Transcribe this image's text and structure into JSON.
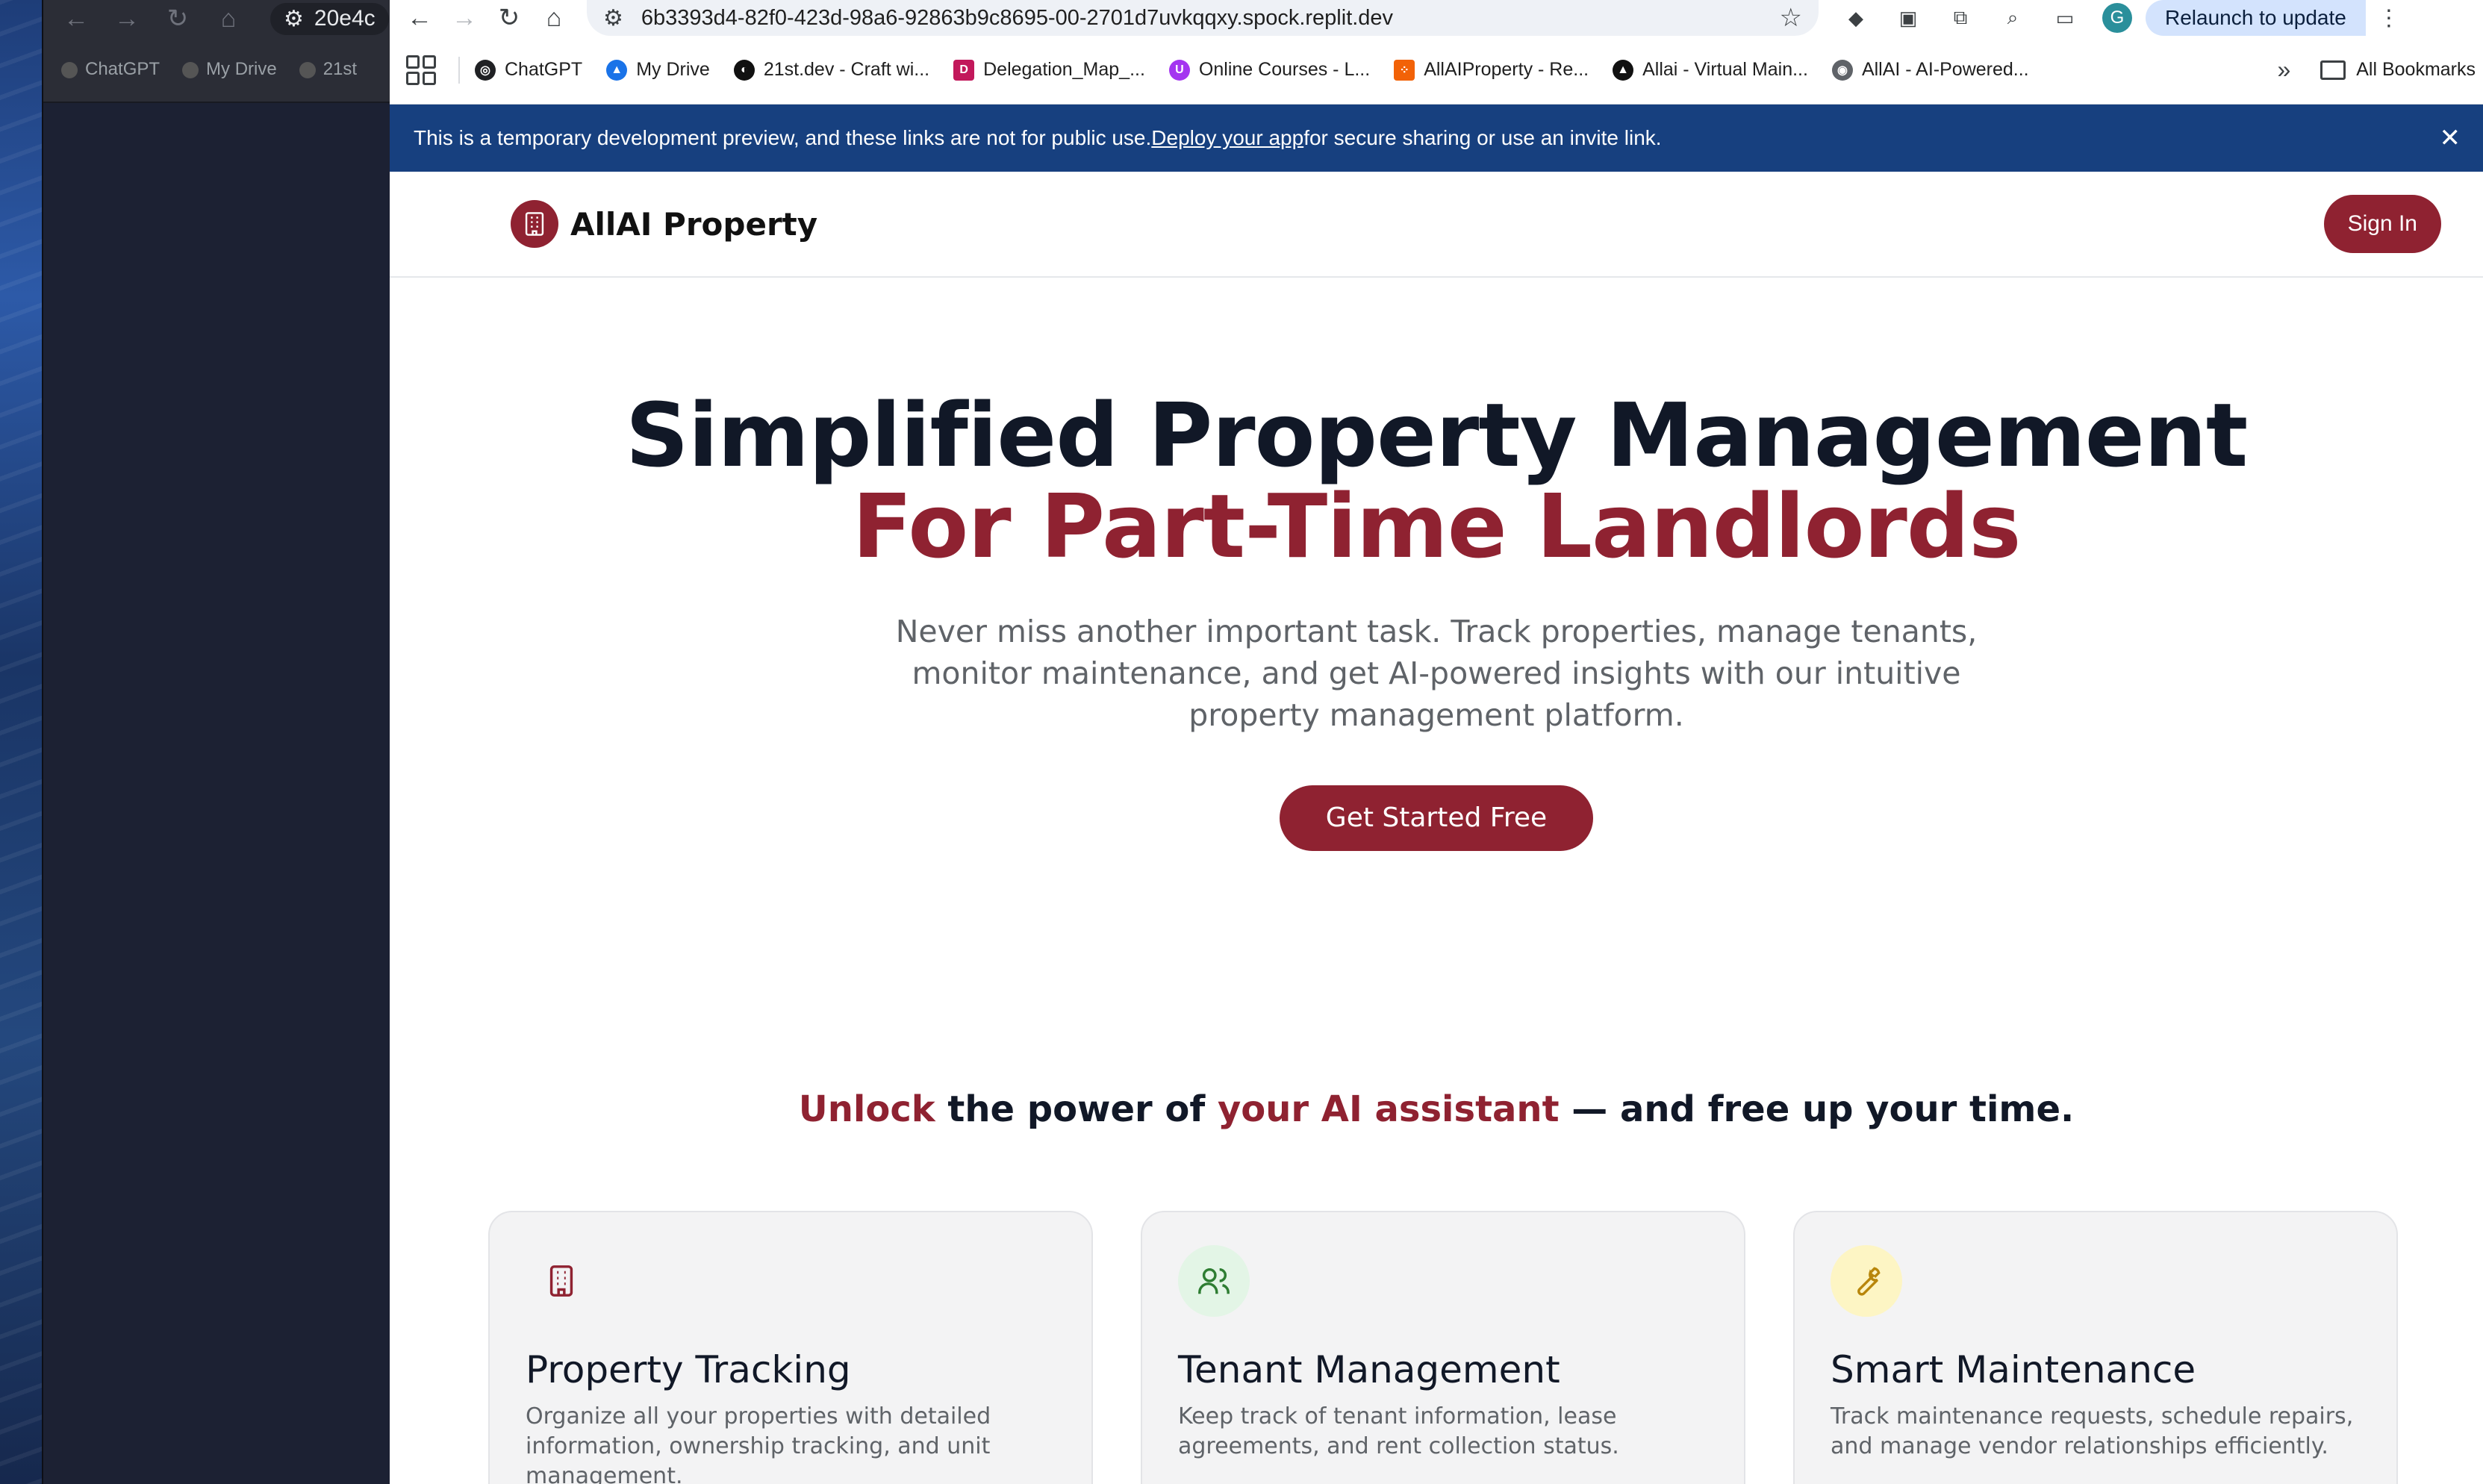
{
  "background_window": {
    "url_fragment": "20e4c",
    "bookmarks": [
      "ChatGPT",
      "My Drive",
      "21st"
    ]
  },
  "browser": {
    "url": "6b3393d4-82f0-423d-98a6-92863b9c8695-00-2701d7uvkqqxy.spock.replit.dev",
    "profile_initial": "G",
    "relaunch_label": "Relaunch to update",
    "bookmarks": [
      {
        "label": "ChatGPT",
        "icon": "openai-icon",
        "color": "#202124"
      },
      {
        "label": "My Drive",
        "icon": "drive-icon",
        "color": "#1a73e8"
      },
      {
        "label": "21st.dev - Craft wi...",
        "icon": "21st-icon",
        "color": "#111111"
      },
      {
        "label": "Delegation_Map_...",
        "icon": "doc-icon",
        "color": "#c2185b"
      },
      {
        "label": "Online Courses - L...",
        "icon": "udemy-icon",
        "color": "#a435f0"
      },
      {
        "label": "AllAIProperty - Re...",
        "icon": "replit-icon",
        "color": "#f26207"
      },
      {
        "label": "Allai - Virtual Main...",
        "icon": "triangle-icon",
        "color": "#111111"
      },
      {
        "label": "AllAI - AI-Powered...",
        "icon": "globe-icon",
        "color": "#5f6368"
      }
    ],
    "all_bookmarks_label": "All Bookmarks"
  },
  "banner": {
    "text_before": "This is a temporary development preview, and these links are not for public use. ",
    "link": "Deploy your app",
    "text_after": " for secure sharing or use an invite link."
  },
  "site": {
    "brand": "AllAI Property",
    "sign_in": "Sign In",
    "accent_color": "#8f2231"
  },
  "hero": {
    "title_line1": "Simplified Property Management",
    "title_line2": "For Part-Time Landlords",
    "subtitle": "Never miss another important task. Track properties, manage tenants, monitor maintenance, and get AI-powered insights with our intuitive property management platform.",
    "cta": "Get Started Free"
  },
  "unlock": {
    "part1": "Unlock",
    "part2": " the power of ",
    "part3": "your AI assistant",
    "part4": " — and free up your time."
  },
  "features": [
    {
      "title": "Property Tracking",
      "description": "Organize all your properties with detailed information, ownership tracking, and unit management.",
      "icon": "building-icon",
      "icon_bg": "#f3f3f4",
      "icon_color": "#8f2231"
    },
    {
      "title": "Tenant Management",
      "description": "Keep track of tenant information, lease agreements, and rent collection status.",
      "icon": "users-icon",
      "icon_bg": "#e3f5e6",
      "icon_color": "#2e7d32"
    },
    {
      "title": "Smart Maintenance",
      "description": "Track maintenance requests, schedule repairs, and manage vendor relationships efficiently.",
      "icon": "wrench-icon",
      "icon_bg": "#fdf5c4",
      "icon_color": "#b8860b"
    }
  ]
}
